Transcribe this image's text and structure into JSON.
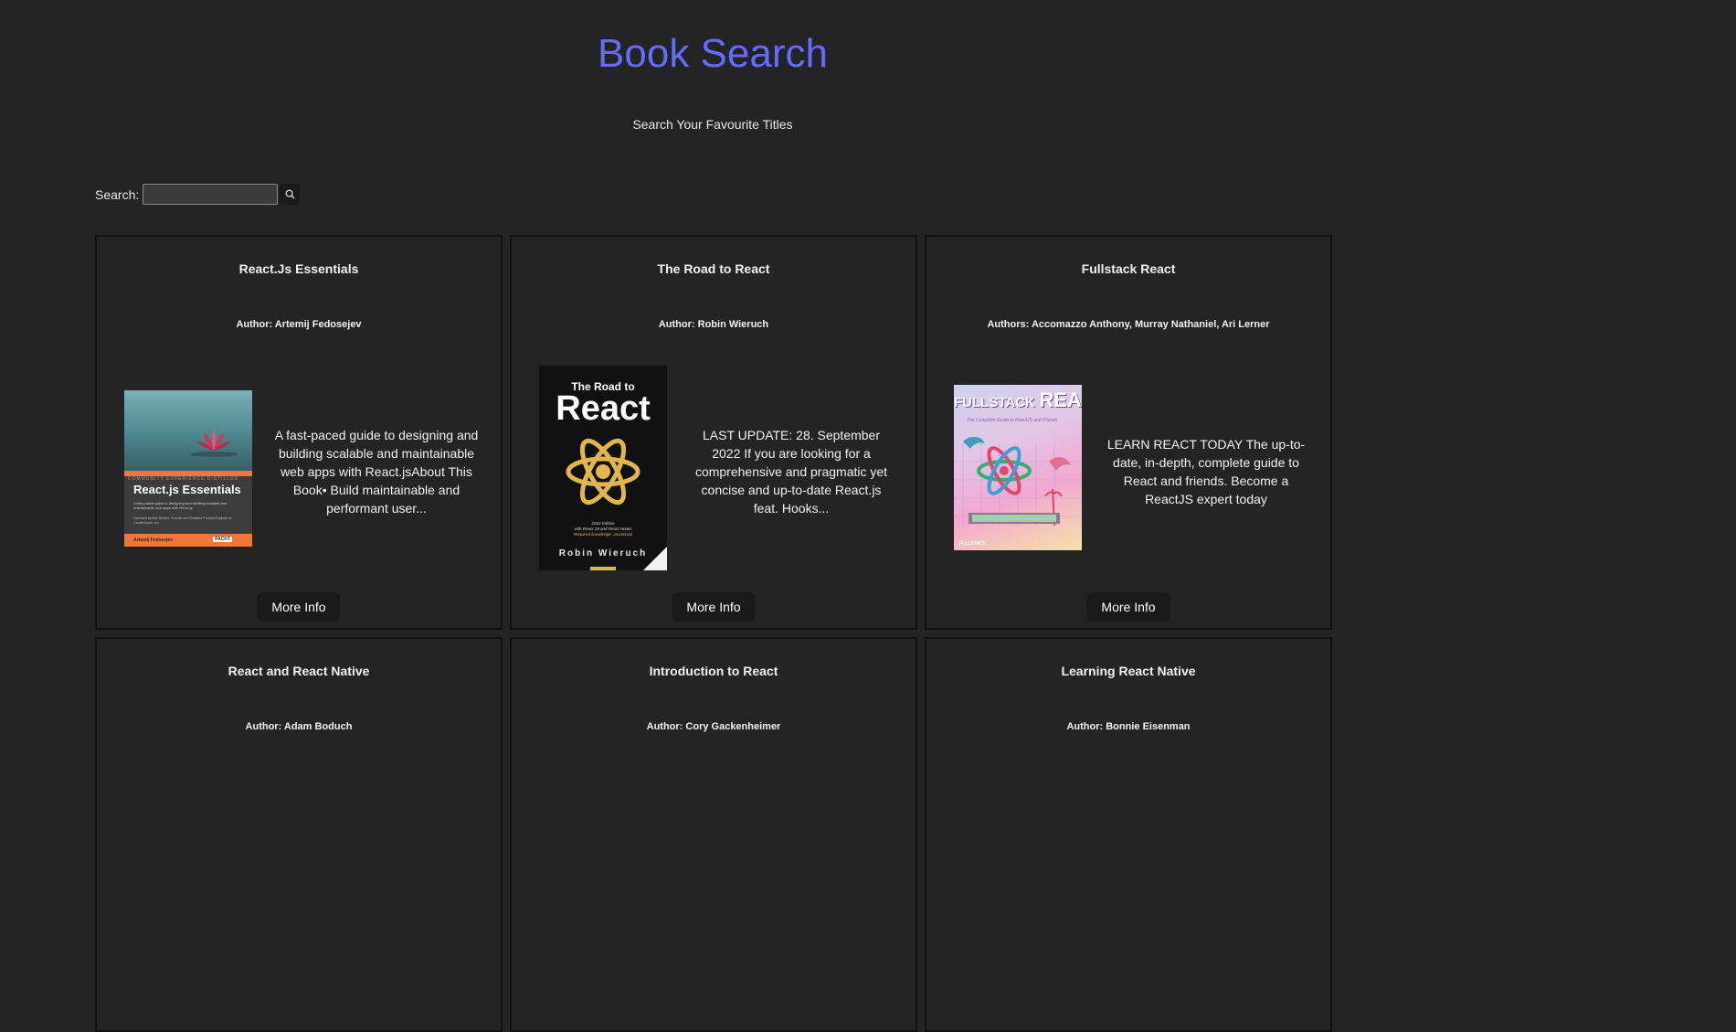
{
  "header": {
    "title": "Book Search",
    "subtitle": "Search Your Favourite Titles"
  },
  "search": {
    "label": "Search:",
    "value": "",
    "placeholder": "",
    "button_icon": "search-icon"
  },
  "books": [
    {
      "title": "React.Js Essentials",
      "author": "Author: Artemij Fedosejev",
      "description": "A fast-paced guide to designing and building scalable and maintainable web apps with React.jsAbout This Book• Build maintainable and performant user...",
      "button": "More Info",
      "cover": {
        "series": "Community Experience Distilled",
        "title": "React.js Essentials",
        "tagline": "A fast-paced guide to designing and building scalable and maintainable web apps with React.js",
        "foreword": "Foreword by Max Stoiber, Founder and Software Product Engineer at GrowthSpace, Inc.",
        "author": "Artemij Fedosejev",
        "publisher": "PACKT"
      }
    },
    {
      "title": "The Road to React",
      "author": "Author: Robin Wieruch",
      "description": "LAST UPDATE: 28. September 2022 If you are looking for a comprehensive and pragmatic yet concise and up-to-date React.js feat. Hooks...",
      "button": "More Info",
      "cover": {
        "title_line1": "The Road to",
        "title_line2": "React",
        "edition": "2022 Edition",
        "edition_sub": "with React 18 and React Hooks",
        "required": "Required knowledge: JavaScript",
        "author": "Robin Wieruch"
      }
    },
    {
      "title": "Fullstack React",
      "author": "Authors: Accomazzo Anthony, Murray Nathaniel, Ari Lerner",
      "description": "LEARN REACT TODAY The up-to-date, in-depth, complete guide to React and friends. Become a ReactJS expert today",
      "button": "More Info",
      "cover": {
        "title_line1": "FULLSTACK",
        "title_line2": "REACT",
        "subtitle": "The Complete Guide to ReactJS and Friends",
        "publisher": "FULLSTACK"
      }
    },
    {
      "title": "React and React Native",
      "author": "Author: Adam Boduch"
    },
    {
      "title": "Introduction to React",
      "author": "Author: Cory Gackenheimer"
    },
    {
      "title": "Learning React Native",
      "author": "Author: Bonnie Eisenman"
    }
  ],
  "colors": {
    "background": "#242424",
    "accent": "#646cff",
    "button_bg": "#1a1a1a",
    "card_border": "#111111"
  }
}
